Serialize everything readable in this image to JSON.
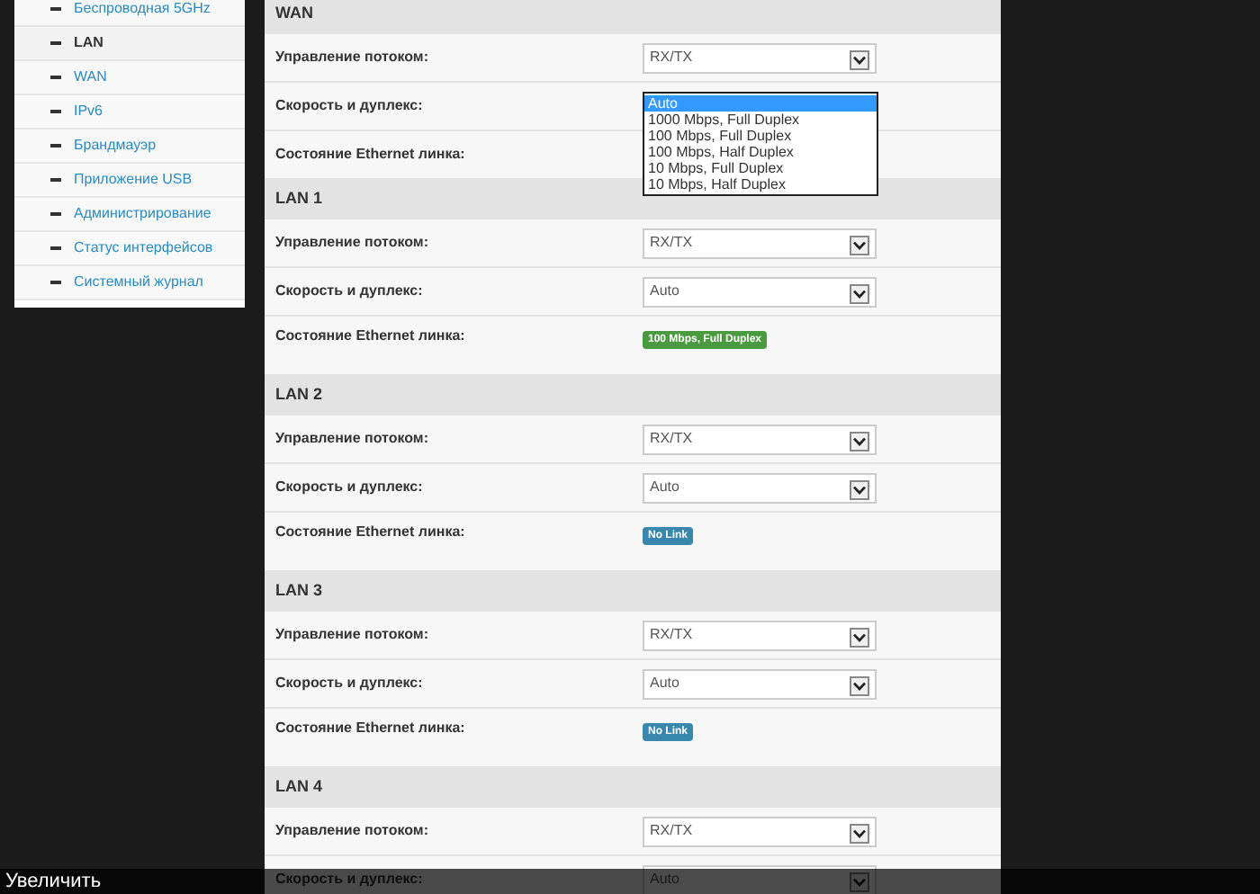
{
  "sidebar": {
    "items": [
      {
        "label": "Беспроводная 5GHz",
        "selected": false
      },
      {
        "label": "LAN",
        "selected": true
      },
      {
        "label": "WAN",
        "selected": false
      },
      {
        "label": "IPv6",
        "selected": false
      },
      {
        "label": "Брандмауэр",
        "selected": false
      },
      {
        "label": "Приложение USB",
        "selected": false
      },
      {
        "label": "Администрирование",
        "selected": false
      },
      {
        "label": "Статус интерфейсов",
        "selected": false
      },
      {
        "label": "Системный журнал",
        "selected": false
      }
    ]
  },
  "sections": [
    {
      "title": "WAN",
      "rows": [
        {
          "kind": "select",
          "label": "Управление потоком:",
          "value": "RX/TX"
        },
        {
          "kind": "dropdown",
          "label": "Скорость и дуплекс:",
          "options": [
            {
              "label": "Auto",
              "selected": true
            },
            {
              "label": "1000 Mbps, Full Duplex",
              "selected": false
            },
            {
              "label": "100 Mbps, Full Duplex",
              "selected": false
            },
            {
              "label": "100 Mbps, Half Duplex",
              "selected": false
            },
            {
              "label": "10 Mbps, Full Duplex",
              "selected": false
            },
            {
              "label": "10 Mbps, Half Duplex",
              "selected": false
            }
          ]
        },
        {
          "kind": "status",
          "label": "Состояние Ethernet линка:"
        }
      ]
    },
    {
      "title": "LAN 1",
      "rows": [
        {
          "kind": "select",
          "label": "Управление потоком:",
          "value": "RX/TX"
        },
        {
          "kind": "select",
          "label": "Скорость и дуплекс:",
          "value": "Auto"
        },
        {
          "kind": "status",
          "label": "Состояние Ethernet линка:",
          "badge": {
            "text": "100 Mbps, Full Duplex",
            "color": "#4a9a3f"
          }
        }
      ]
    },
    {
      "title": "LAN 2",
      "rows": [
        {
          "kind": "select",
          "label": "Управление потоком:",
          "value": "RX/TX"
        },
        {
          "kind": "select",
          "label": "Скорость и дуплекс:",
          "value": "Auto"
        },
        {
          "kind": "status",
          "label": "Состояние Ethernet линка:",
          "badge": {
            "text": "No Link",
            "color": "#3a87ad"
          }
        }
      ]
    },
    {
      "title": "LAN 3",
      "rows": [
        {
          "kind": "select",
          "label": "Управление потоком:",
          "value": "RX/TX"
        },
        {
          "kind": "select",
          "label": "Скорость и дуплекс:",
          "value": "Auto"
        },
        {
          "kind": "status",
          "label": "Состояние Ethernet линка:",
          "badge": {
            "text": "No Link",
            "color": "#3a87ad"
          }
        }
      ]
    },
    {
      "title": "LAN 4",
      "rows": [
        {
          "kind": "select",
          "label": "Управление потоком:",
          "value": "RX/TX"
        },
        {
          "kind": "select",
          "label": "Скорость и дуплекс:",
          "value": "Auto"
        }
      ]
    }
  ],
  "overlay_bar": {
    "label": "Увеличить"
  }
}
